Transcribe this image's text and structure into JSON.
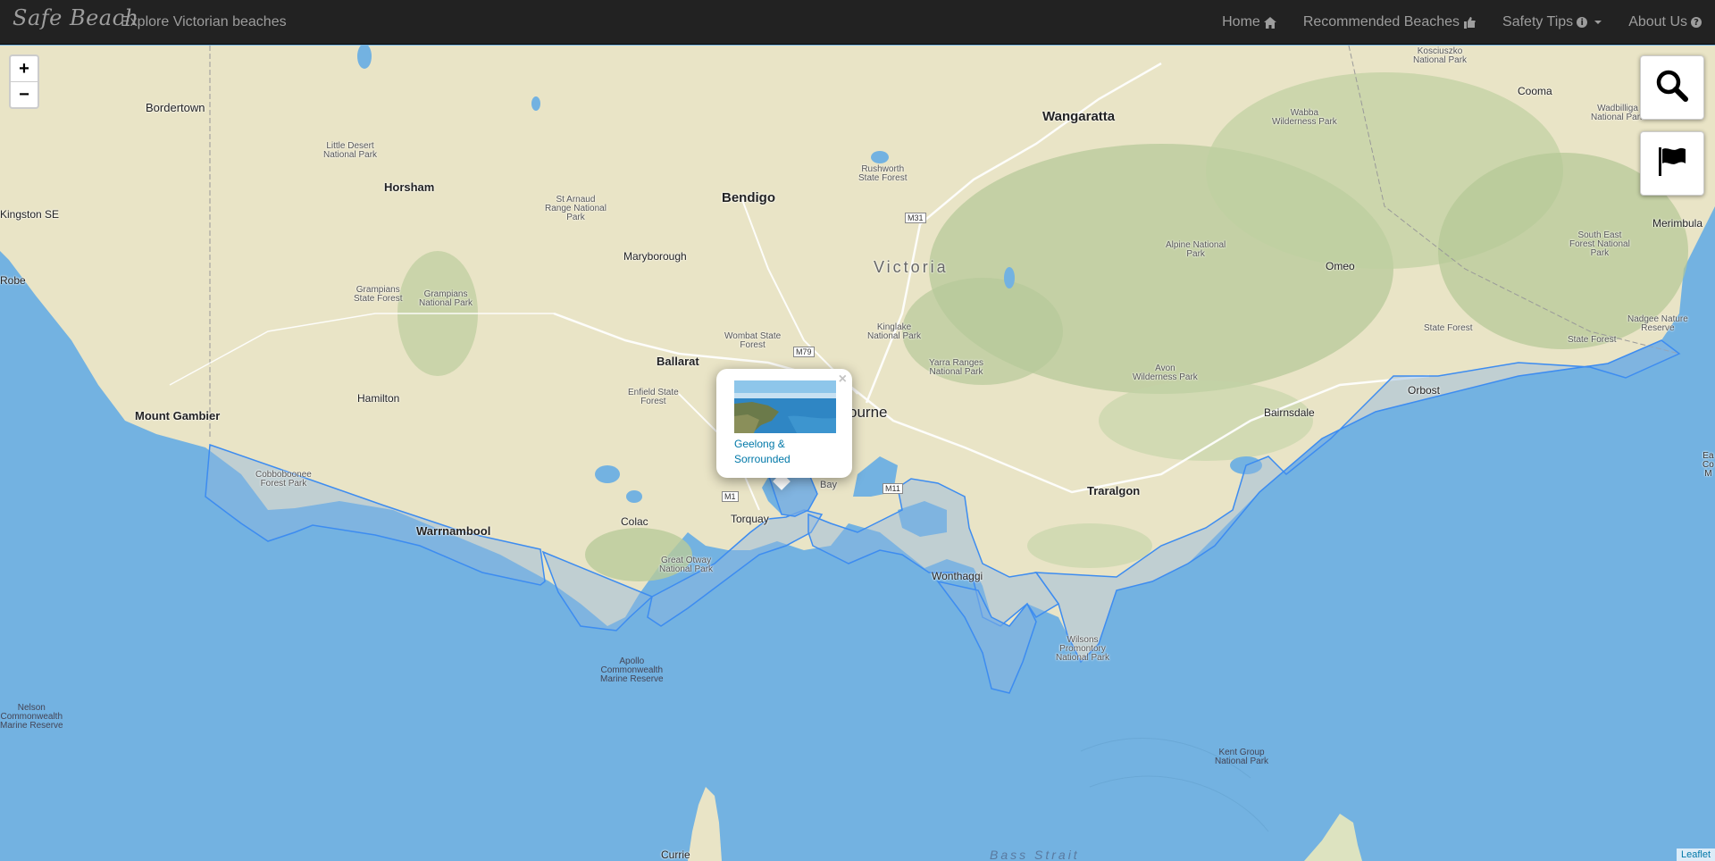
{
  "brand": {
    "name": "Safe Beach",
    "tagline": "Explore Victorian beaches"
  },
  "nav": {
    "home": "Home",
    "recommended": "Recommended Beaches",
    "safety": "Safety Tips",
    "about": "About Us"
  },
  "map": {
    "zoom_in": "+",
    "zoom_out": "−",
    "attribution": "Leaflet",
    "places": {
      "bordertown": "Bordertown",
      "little_desert": "Little Desert\nNational Park",
      "horsham": "Horsham",
      "kingston": "Kingston SE",
      "robe": "Robe",
      "st_arnaud": "St Arnaud\nRange National\nPark",
      "bendigo": "Bendigo",
      "rushworth": "Rushworth\nState Forest",
      "wangaratta": "Wangaratta",
      "kosciuszko": "Kosciuszko\nNational Park",
      "wabba": "Wabba\nWilderness Park",
      "cooma": "Cooma",
      "wadbilliga": "Wadbilliga\nNational Park",
      "merimbula": "Merimbula",
      "maryborough": "Maryborough",
      "victoria": "Victoria",
      "alpine": "Alpine National\nPark",
      "omeo": "Omeo",
      "south_east_forest": "South East\nForest National\nPark",
      "grampians_sf": "Grampians\nState Forest",
      "grampians_np": "Grampians\nNational Park",
      "wombat": "Wombat State\nForest",
      "kinglake": "Kinglake\nNational Park",
      "nadgee": "Nadgee Nature\nReserve",
      "state_forest_1": "State Forest",
      "state_forest_2": "State Forest",
      "ballarat": "Ballarat",
      "yarra": "Yarra Ranges\nNational Park",
      "avon": "Avon\nWilderness Park",
      "orbost": "Orbost",
      "hamilton": "Hamilton",
      "enfield": "Enfield State\nForest",
      "melbourne": "ourne",
      "bairnsdale": "Bairnsdale",
      "mount_gambier": "Mount Gambier",
      "cobboboonee": "Cobboboonee\nForest Park",
      "bay": "Bay",
      "traralgon": "Traralgon",
      "torquay": "Torquay",
      "colac": "Colac",
      "warrnambool": "Warrnambool",
      "otway": "Great Otway\nNational Park",
      "wonthaggi": "Wonthaggi",
      "wilsons": "Wilsons\nPromontory\nNational Park",
      "apollo": "Apollo\nCommonwealth\nMarine Reserve",
      "nelson": "Nelson\nCommonwealth\nMarine Reserve",
      "kent": "Kent Group\nNational Park",
      "currie": "Currie",
      "bass": "Bass Strait",
      "east_edge": "Ea\nCo\nM"
    },
    "shields": {
      "m31": "M31",
      "m79": "M79",
      "m1": "M1",
      "m11": "M11"
    }
  },
  "popup": {
    "title": "Geelong & Sorrounded",
    "close": "×"
  },
  "colors": {
    "land": "#e9e4c6",
    "water": "#73b2e1",
    "zone_stroke": "#3d8cf0",
    "forest": "#b7c99a"
  }
}
